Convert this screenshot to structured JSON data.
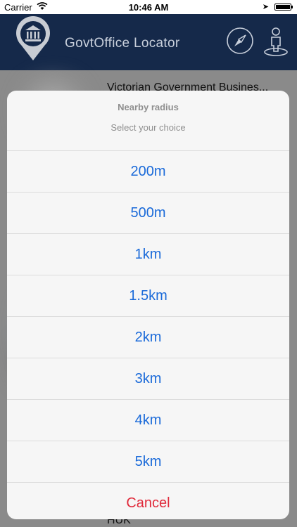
{
  "status_bar": {
    "carrier": "Carrier",
    "time": "10:46 AM"
  },
  "header": {
    "title": "GovtOffice Locator"
  },
  "background_list": {
    "first_item": "Victorian Government Busines...",
    "last_item": "HUK"
  },
  "sheet": {
    "title": "Nearby radius",
    "message": "Select your choice",
    "options": [
      "200m",
      "500m",
      "1km",
      "1.5km",
      "2km",
      "3km",
      "4km",
      "5km"
    ],
    "cancel": "Cancel"
  },
  "colors": {
    "header_bg": "#15294a",
    "option_text": "#1a6ad9",
    "cancel_text": "#e0293a"
  }
}
